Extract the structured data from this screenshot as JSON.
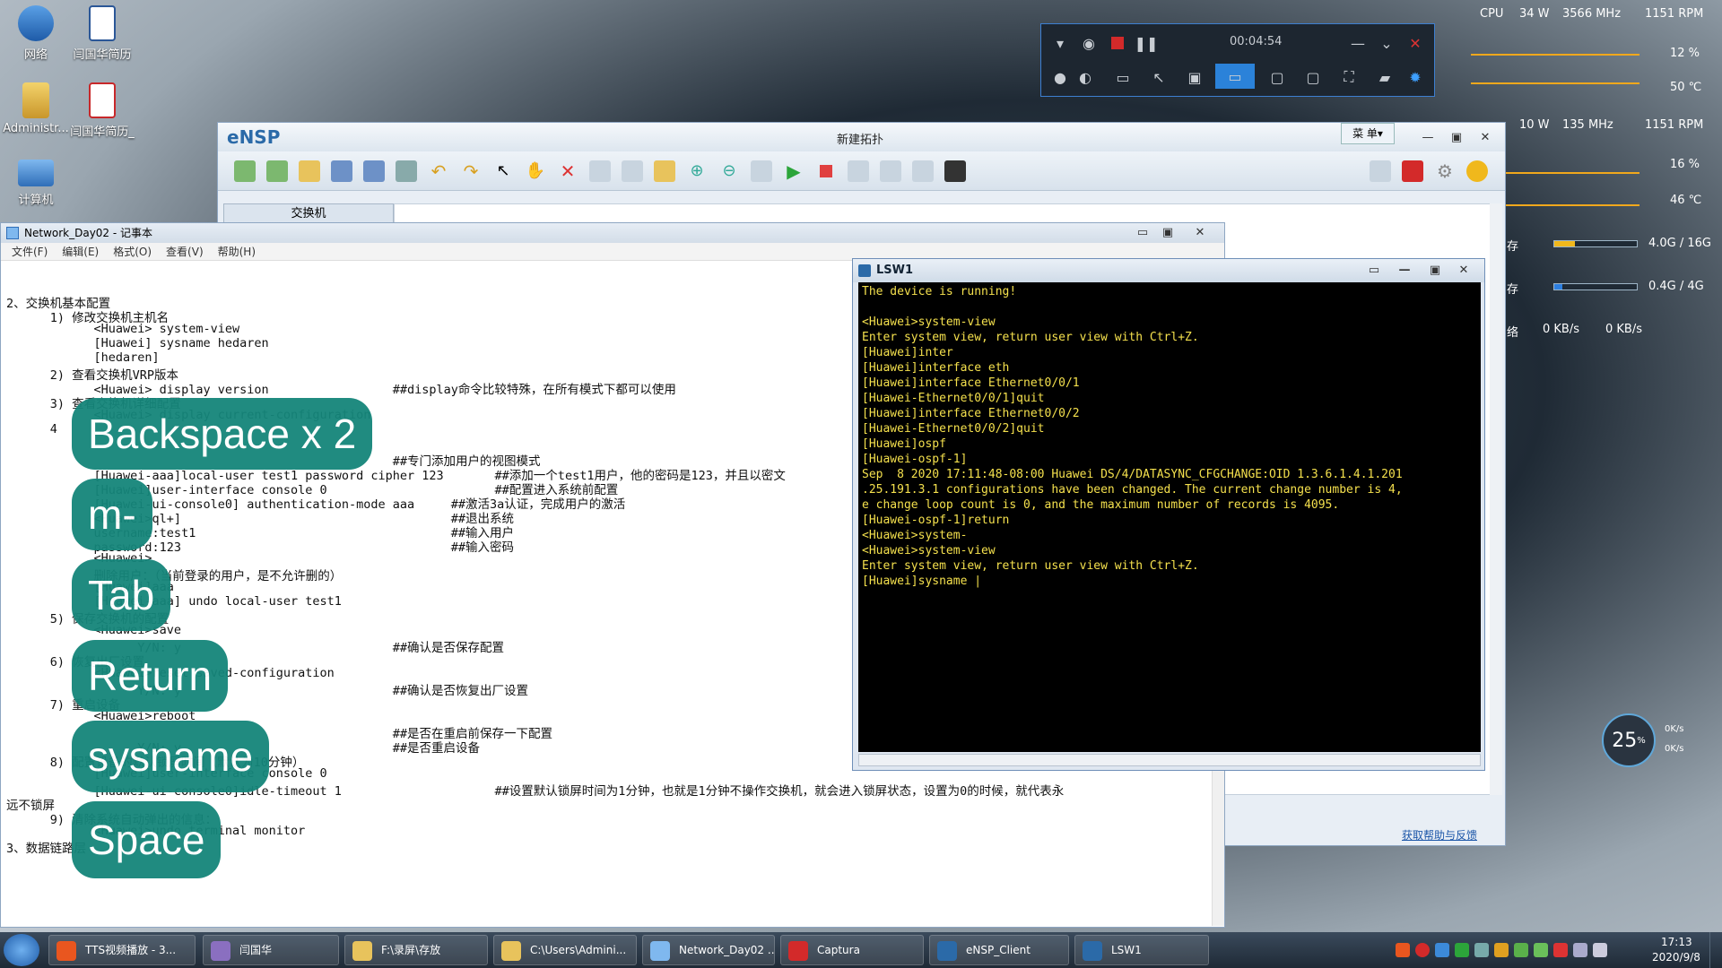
{
  "desktop": {
    "icons": [
      {
        "label": "网络"
      },
      {
        "label": "闫国华简历"
      },
      {
        "label": "Administr..."
      },
      {
        "label": "闫国华简历_"
      },
      {
        "label": "计算机"
      }
    ]
  },
  "recorder": {
    "time": "00:04:54"
  },
  "monitor": {
    "cpu_label": "CPU",
    "cpu_power": "34 W",
    "cpu_freq": "3566 MHz",
    "fan1": "1151 RPM",
    "cpu_load": "12 %",
    "cpu_temp": "50 ℃",
    "gpu_power": "10 W",
    "gpu_freq": "135 MHz",
    "fan2": "1151 RPM",
    "gpu_load": "16 %",
    "gpu_temp": "46 ℃",
    "ram": "4.0G / 16G",
    "ram_fraction": 0.25,
    "vram": "0.4G / 4G",
    "vram_fraction": 0.1,
    "net_down": "0 KB/s",
    "net_up": "0 KB/s",
    "gauge_pct": "25",
    "gauge_pct_suffix": "%",
    "gauge_up": "0K/s",
    "gauge_down": "0K/s",
    "row_labels": [
      "存",
      "存",
      "络"
    ]
  },
  "ensp": {
    "logo": "eNSP",
    "title": "新建拓扑",
    "menu_label": "菜 单▾",
    "tab_label": "交换机",
    "feedback": "获取帮助与反馈"
  },
  "notepad": {
    "title": "Network_Day02 - 记事本",
    "menu": [
      "文件(F)",
      "编辑(E)",
      "格式(O)",
      "查看(V)",
      "帮助(H)"
    ],
    "lines": [
      "2、交换机基本配置",
      "      1) 修改交换机主机名",
      "            <Huawei> system-view",
      "            [Huawei] sysname hedaren",
      "            [hedaren]",
      "      2) 查看交换机VRP版本",
      "            <Huawei> display version                 ##display命令比较特殊，在所有模式下都可以使用",
      "      3) 查看交换机详细配置",
      "            <Huawei> display current-configuration",
      "      4",
      "                                                     ##专门添加用户的视图模式",
      "            [Huawei-aaa]local-user test1 password cipher 123       ##添加一个test1用户，他的密码是123，并且以密文",
      "            [Huawei]user-interface console 0                       ##配置进入系统前配置",
      "            [Huawei-ui-console0] authentication-mode aaa     ##激活3a认证，完成用户的激活",
      "            <Huawei>ql+]                                     ##退出系统",
      "            username:test1                                   ##输入用户",
      "            password:123                                     ##输入密码",
      "            <Huawei>",
      "            删除用户：（当前登录的用户，是不允许删的）",
      "            [Huawei]aaa",
      "            [Huawei-aaa] undo local-user test1",
      "      5) 保存交换机的配置",
      "            <Huawei>save",
      "                  Y/N: y                             ##确认是否保存配置",
      "      6) 恢复出厂设置",
      "            <Huawei>reset saved-configuration",
      "                  Y/N: y                             ##确认是否恢复出厂设置",
      "      7) 重启设备",
      "            <Huawei>reboot",
      "                                                     ##是否在重启前保存一下配置",
      "                  Y/N: y                             ##是否重启设备",
      "      8) 配置设备的默认锁屏时间（默认为10分钟）",
      "            [Huawei]user-interface console 0",
      "            [Huawei-ui-console0]idle-timeout 1                     ##设置默认锁屏时间为1分钟，也就是1分钟不操作交换机，就会进入锁屏状态，设置为0的时候，就代表永",
      "远不锁屏",
      "      9) 清除系统自动弹出的信息：",
      "            <Huawei>undo terminal monitor",
      "3、数据链路层"
    ]
  },
  "keys": [
    "Backspace x 2",
    "m-",
    "Tab",
    "Return",
    "sysname",
    "Space"
  ],
  "lsw1": {
    "title": "LSW1",
    "lines": [
      "The device is running!",
      "",
      "<Huawei>system-view",
      "Enter system view, return user view with Ctrl+Z.",
      "[Huawei]inter",
      "[Huawei]interface eth",
      "[Huawei]interface Ethernet0/0/1",
      "[Huawei-Ethernet0/0/1]quit",
      "[Huawei]interface Ethernet0/0/2",
      "[Huawei-Ethernet0/0/2]quit",
      "[Huawei]ospf",
      "[Huawei-ospf-1]",
      "Sep  8 2020 17:11:48-08:00 Huawei DS/4/DATASYNC_CFGCHANGE:OID 1.3.6.1.4.1.201",
      ".25.191.3.1 configurations have been changed. The current change number is 4,",
      "e change loop count is 0, and the maximum number of records is 4095.",
      "[Huawei-ospf-1]return",
      "<Huawei>system-",
      "<Huawei>system-view",
      "Enter system view, return user view with Ctrl+Z.",
      "[Huawei]sysname |"
    ]
  },
  "taskbar": {
    "items": [
      {
        "label": "TTS视频播放 - 3..."
      },
      {
        "label": "闫国华"
      },
      {
        "label": "F:\\录屏\\存放"
      },
      {
        "label": "C:\\Users\\Admini..."
      },
      {
        "label": "Network_Day02 ..."
      },
      {
        "label": "Captura"
      },
      {
        "label": "eNSP_Client"
      },
      {
        "label": "LSW1"
      }
    ],
    "time": "17:13",
    "date": "2020/9/8"
  },
  "colors": {
    "terminal_text": "#f4e04d",
    "key_overlay": "#15857a"
  }
}
